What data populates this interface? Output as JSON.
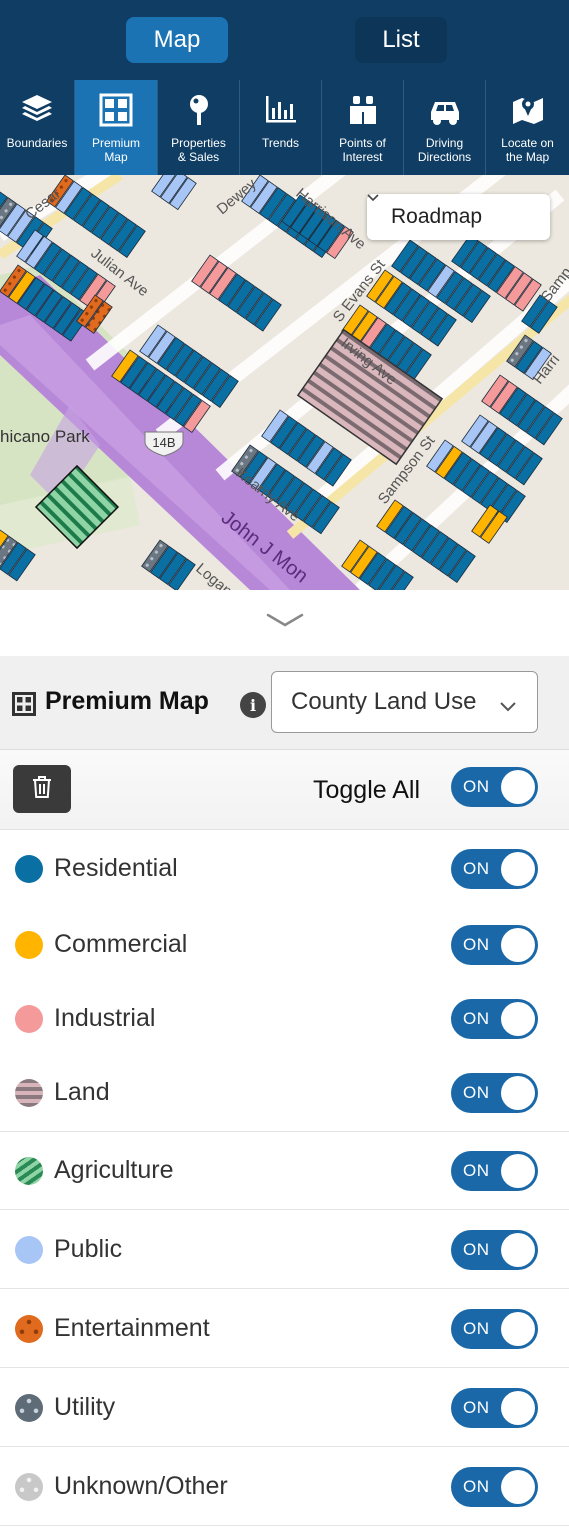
{
  "header": {
    "tab_map": "Map",
    "tab_list": "List"
  },
  "toolbar": {
    "tools": [
      {
        "label": "Boundaries",
        "icon": "layers-icon"
      },
      {
        "label": "Premium\nMap",
        "icon": "grid-icon",
        "active": true
      },
      {
        "label": "Properties\n& Sales",
        "icon": "pin-icon"
      },
      {
        "label": "Trends",
        "icon": "bar-chart-icon"
      },
      {
        "label": "Points of\nInterest",
        "icon": "binoculars-icon"
      },
      {
        "label": "Driving\nDirections",
        "icon": "car-icon"
      },
      {
        "label": "Locate on\nthe Map",
        "icon": "map-pin-icon"
      }
    ]
  },
  "map": {
    "roadmap_label": "Roadmap",
    "labels": {
      "cesar": "Cesar",
      "julian_ave": "Julian Ave",
      "dewey": "Dewey",
      "harrison_ave": "Harrison Ave",
      "s_evans_st": "S Evans St",
      "irving_ave": "Irving Ave",
      "sampson_st": "Sampson St",
      "harri": "Harri",
      "chicano_park": "hicano Park",
      "highway_14b": "14B",
      "kearny_ave": "Kearny Ave",
      "john_j_mon": "John J Mon",
      "logan_a": "Logan A",
      "samp": "Samp"
    }
  },
  "premium_map": {
    "title": "Premium Map",
    "info_icon": "i",
    "dataset_select": "County Land Use",
    "toggle_all_label": "Toggle All",
    "toggle_all_state": "ON"
  },
  "categories": [
    {
      "label": "Residential",
      "state": "ON",
      "color": "#0a6fa3",
      "pattern": "solid"
    },
    {
      "label": "Commercial",
      "state": "ON",
      "color": "#ffb400",
      "pattern": "solid"
    },
    {
      "label": "Industrial",
      "state": "ON",
      "color": "#f59a9a",
      "pattern": "solid"
    },
    {
      "label": "Land",
      "state": "ON",
      "color": "#b09aa0",
      "pattern": "stripes"
    },
    {
      "label": "Agriculture",
      "state": "ON",
      "color": "#3e9a6a",
      "pattern": "stripes"
    },
    {
      "label": "Public",
      "state": "ON",
      "color": "#a8c6f5",
      "pattern": "solid"
    },
    {
      "label": "Entertainment",
      "state": "ON",
      "color": "#e06a1e",
      "pattern": "dots"
    },
    {
      "label": "Utility",
      "state": "ON",
      "color": "#5e6c78",
      "pattern": "dots"
    },
    {
      "label": "Unknown/Other",
      "state": "ON",
      "color": "#c8c8c8",
      "pattern": "dots"
    }
  ]
}
